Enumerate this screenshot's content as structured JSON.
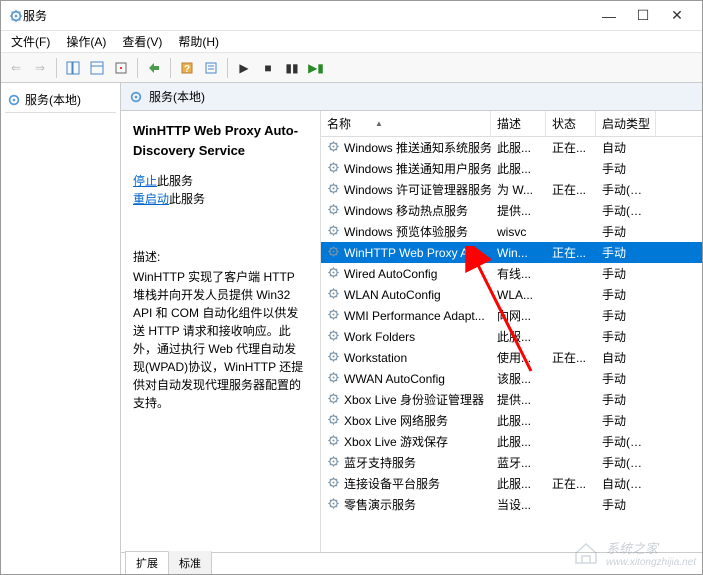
{
  "window": {
    "title": "服务"
  },
  "menu": {
    "file": "文件(F)",
    "action": "操作(A)",
    "view": "查看(V)",
    "help": "帮助(H)"
  },
  "left_panel": {
    "label": "服务(本地)"
  },
  "right_header": {
    "label": "服务(本地)"
  },
  "detail": {
    "title": "WinHTTP Web Proxy Auto-Discovery Service",
    "stop_link": "停止",
    "stop_suffix": "此服务",
    "restart_link": "重启动",
    "restart_suffix": "此服务",
    "desc_label": "描述:",
    "desc": "WinHTTP 实现了客户端 HTTP 堆栈并向开发人员提供 Win32 API 和 COM 自动化组件以供发送 HTTP 请求和接收响应。此外，通过执行 Web 代理自动发现(WPAD)协议，WinHTTP 还提供对自动发现代理服务器配置的支持。"
  },
  "columns": {
    "name": "名称",
    "desc": "描述",
    "status": "状态",
    "startup": "启动类型"
  },
  "services": [
    {
      "name": "Windows 推送通知系统服务",
      "desc": "此服...",
      "status": "正在...",
      "startup": "自动",
      "selected": false
    },
    {
      "name": "Windows 推送通知用户服务...",
      "desc": "此服...",
      "status": "",
      "startup": "手动",
      "selected": false
    },
    {
      "name": "Windows 许可证管理器服务",
      "desc": "为 W...",
      "status": "正在...",
      "startup": "手动(触发...",
      "selected": false
    },
    {
      "name": "Windows 移动热点服务",
      "desc": "提供...",
      "status": "",
      "startup": "手动(触发...",
      "selected": false
    },
    {
      "name": "Windows 预览体验服务",
      "desc": "wisvc",
      "status": "",
      "startup": "手动",
      "selected": false
    },
    {
      "name": "WinHTTP Web Proxy Aut...",
      "desc": "Win...",
      "status": "正在...",
      "startup": "手动",
      "selected": true
    },
    {
      "name": "Wired AutoConfig",
      "desc": "有线...",
      "status": "",
      "startup": "手动",
      "selected": false
    },
    {
      "name": "WLAN AutoConfig",
      "desc": "WLA...",
      "status": "",
      "startup": "手动",
      "selected": false
    },
    {
      "name": "WMI Performance Adapt...",
      "desc": "向网...",
      "status": "",
      "startup": "手动",
      "selected": false
    },
    {
      "name": "Work Folders",
      "desc": "此服...",
      "status": "",
      "startup": "手动",
      "selected": false
    },
    {
      "name": "Workstation",
      "desc": "使用...",
      "status": "正在...",
      "startup": "自动",
      "selected": false
    },
    {
      "name": "WWAN AutoConfig",
      "desc": "该服...",
      "status": "",
      "startup": "手动",
      "selected": false
    },
    {
      "name": "Xbox Live 身份验证管理器",
      "desc": "提供...",
      "status": "",
      "startup": "手动",
      "selected": false
    },
    {
      "name": "Xbox Live 网络服务",
      "desc": "此服...",
      "status": "",
      "startup": "手动",
      "selected": false
    },
    {
      "name": "Xbox Live 游戏保存",
      "desc": "此服...",
      "status": "",
      "startup": "手动(触发...",
      "selected": false
    },
    {
      "name": "蓝牙支持服务",
      "desc": "蓝牙...",
      "status": "",
      "startup": "手动(触发...",
      "selected": false
    },
    {
      "name": "连接设备平台服务",
      "desc": "此服...",
      "status": "正在...",
      "startup": "自动(延迟...",
      "selected": false
    },
    {
      "name": "零售演示服务",
      "desc": "当设...",
      "status": "",
      "startup": "手动",
      "selected": false
    }
  ],
  "tabs": {
    "extended": "扩展",
    "standard": "标准"
  },
  "watermark": {
    "text": "系统之家",
    "url": "www.xitongzhijia.net"
  }
}
